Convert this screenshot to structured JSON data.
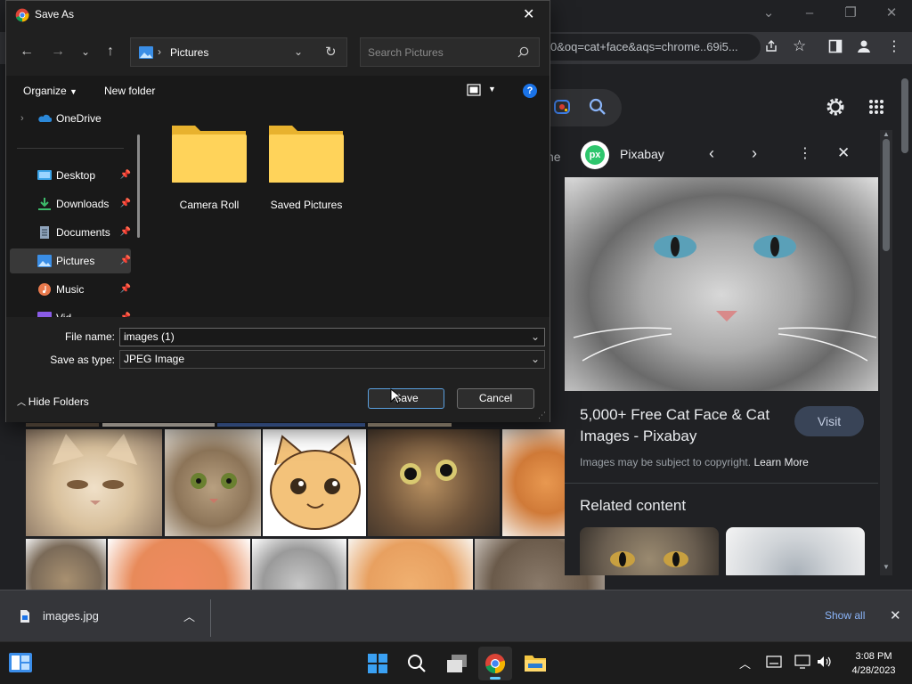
{
  "chrome": {
    "url_fragment": "0&oq=cat+face&aqs=chrome..69i5...",
    "tab_partial_text": "ne"
  },
  "side_panel": {
    "source_name": "Pixabay",
    "source_logo_text": "px",
    "result_title": "5,000+ Free Cat Face & Cat Images - Pixabay",
    "visit_label": "Visit",
    "copyright_note": "Images may be subject to copyright.",
    "learn_more": "Learn More",
    "related_heading": "Related content"
  },
  "download_bar": {
    "file_name": "images.jpg",
    "show_all": "Show all"
  },
  "taskbar": {
    "time": "3:08 PM",
    "date": "4/28/2023"
  },
  "dialog": {
    "title": "Save As",
    "breadcrumb": "Pictures",
    "search_placeholder": "Search Pictures",
    "organize_label": "Organize",
    "new_folder_label": "New folder",
    "nav_items": [
      {
        "label": "OneDrive"
      },
      {
        "label": "Desktop"
      },
      {
        "label": "Downloads"
      },
      {
        "label": "Documents"
      },
      {
        "label": "Pictures"
      },
      {
        "label": "Music"
      },
      {
        "label": "Vid"
      }
    ],
    "folders": [
      {
        "label": "Camera Roll"
      },
      {
        "label": "Saved Pictures"
      }
    ],
    "file_name_label": "File name:",
    "file_name_value": "images (1)",
    "save_type_label": "Save as type:",
    "save_type_value": "JPEG Image",
    "hide_folders_label": "Hide Folders",
    "save_button": "Save",
    "cancel_button": "Cancel"
  },
  "colors": {
    "accent": "#0078d4",
    "folder_yellow": "#f3c642",
    "visit_bg": "#394457",
    "help_blue": "#1a73e8"
  }
}
